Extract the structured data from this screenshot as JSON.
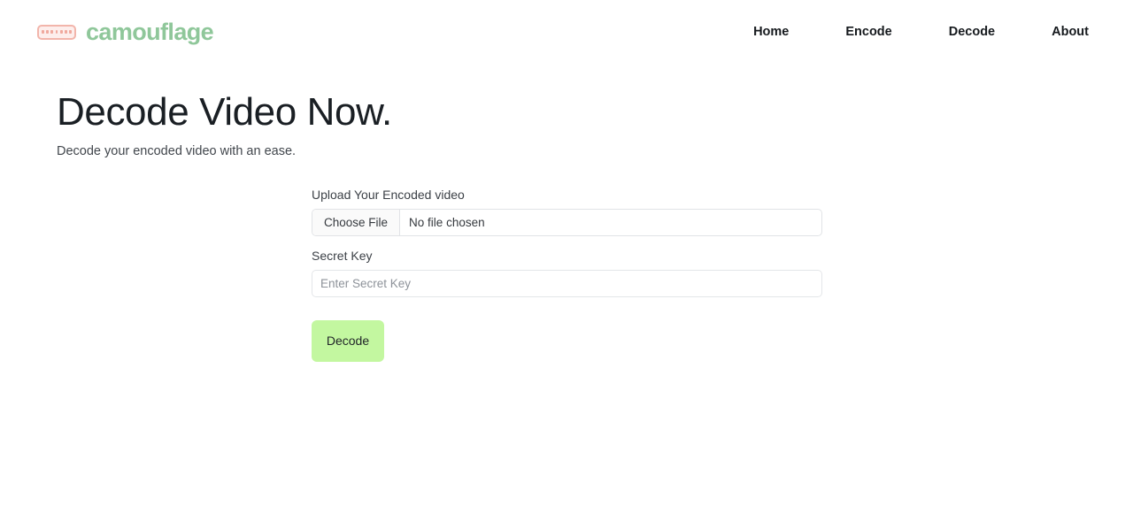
{
  "header": {
    "brand": {
      "icon": "camouflage-strip-icon",
      "dot_count": 7,
      "name": "camouflage",
      "name_color": "#8fc79a",
      "mark_color": "#f2b5ab"
    },
    "nav": [
      {
        "label": "Home"
      },
      {
        "label": "Encode"
      },
      {
        "label": "Decode"
      },
      {
        "label": "About"
      }
    ]
  },
  "hero": {
    "title": "Decode Video Now.",
    "subtitle": "Decode your encoded video with an ease."
  },
  "form": {
    "upload": {
      "label": "Upload Your Encoded video",
      "button_label": "Choose File",
      "status_text": "No file chosen"
    },
    "secret_key": {
      "label": "Secret Key",
      "placeholder": "Enter Secret Key",
      "value": ""
    },
    "submit": {
      "label": "Decode",
      "color": "#c3f7a0"
    }
  }
}
